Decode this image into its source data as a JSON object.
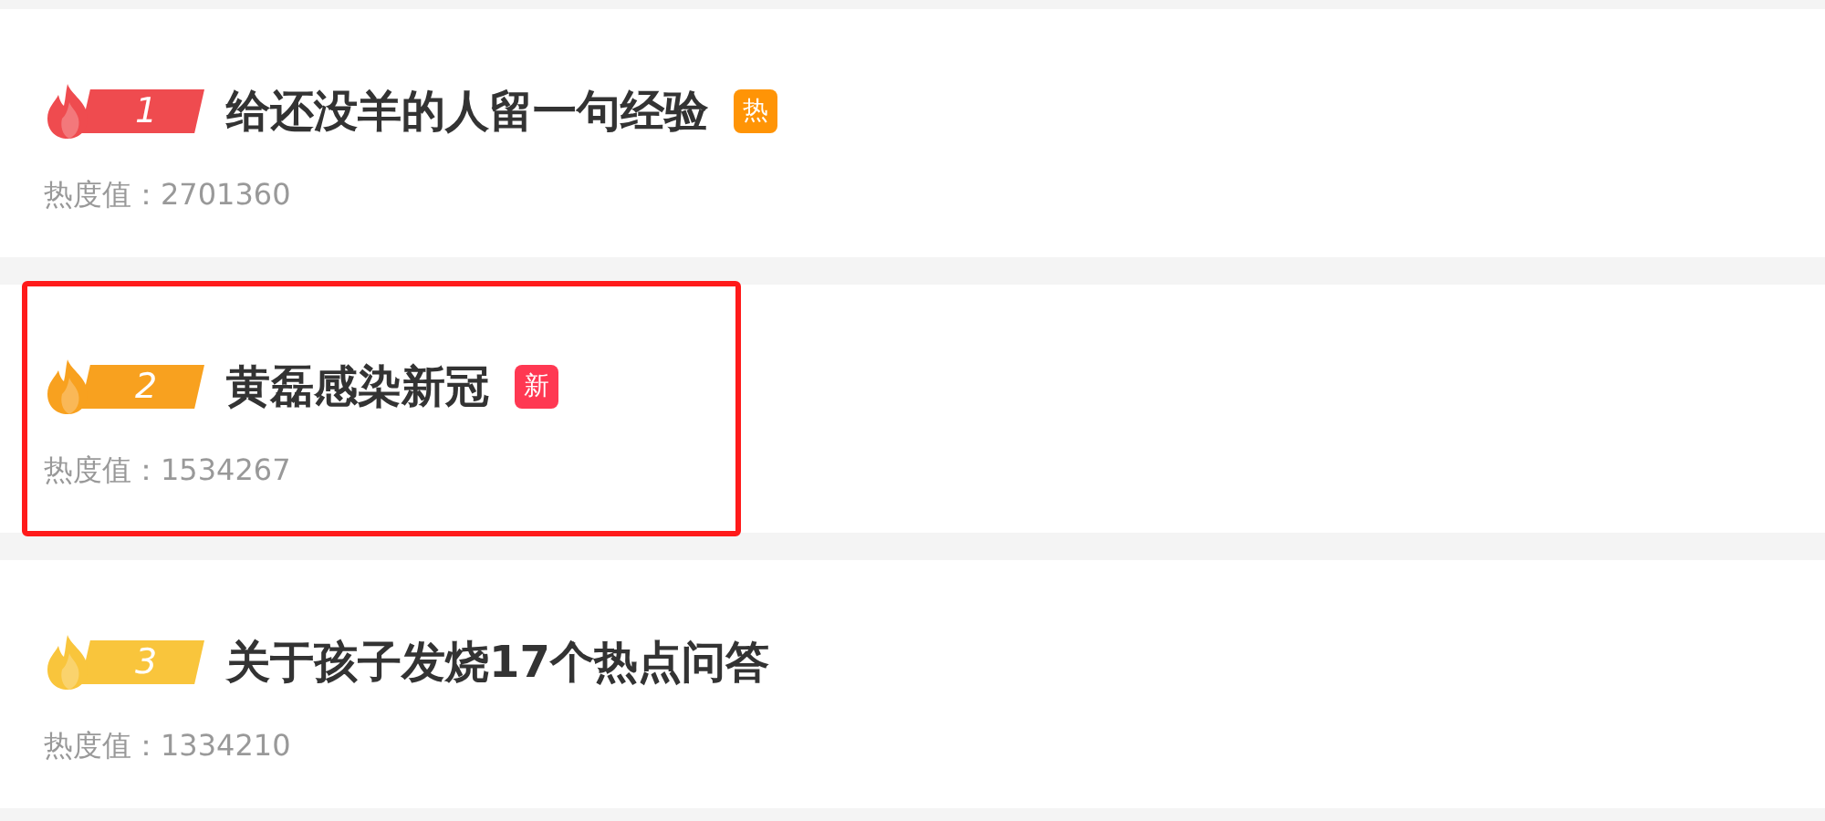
{
  "items": [
    {
      "rank": "1",
      "color": "#ef4b4f",
      "title": "给还没羊的人留一句经验",
      "tag": {
        "kind": "hot",
        "text": "热"
      },
      "heat": "热度值：2701360",
      "highlighted": false
    },
    {
      "rank": "2",
      "color": "#f8a11f",
      "title": "黄磊感染新冠",
      "tag": {
        "kind": "new",
        "text": "新"
      },
      "heat": "热度值：1534267",
      "highlighted": true
    },
    {
      "rank": "3",
      "color": "#f9c53c",
      "title": "关于孩子发烧17个热点问答",
      "heat": "热度值：1334210",
      "highlighted": false
    }
  ]
}
